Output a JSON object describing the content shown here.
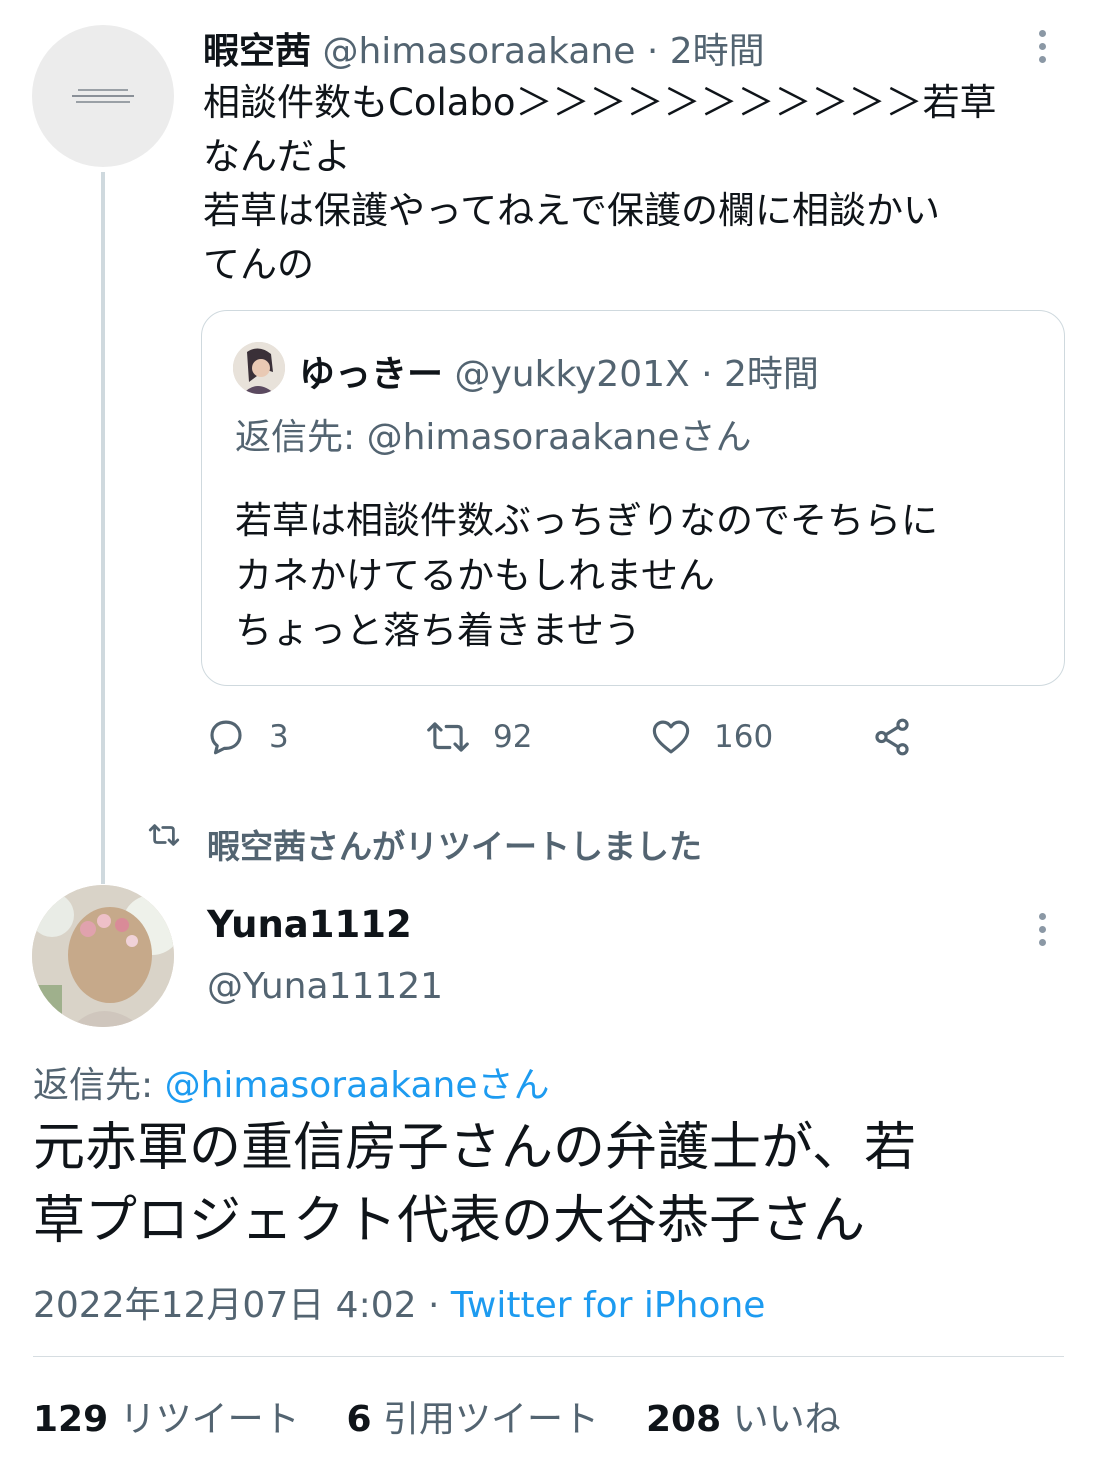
{
  "tweet1": {
    "author_name": "暇空茜",
    "author_handle": "@himasoraakane",
    "time": "· 2時間",
    "lines": [
      "相談件数もColabo＞＞＞＞＞＞＞＞＞＞＞若草",
      "なんだよ",
      "若草は保護やってねえで保護の欄に相談かい",
      "てんの"
    ],
    "quote": {
      "author_name": "ゆっきー",
      "author_handle": "@yukky201X",
      "time": "· 2時間",
      "reply_to": "返信先: @himasoraakaneさん",
      "lines": [
        "若草は相談件数ぶっちぎりなのでそちらに",
        "カネかけてるかもしれません",
        "ちょっと落ち着きませう"
      ]
    },
    "actions": {
      "replies": "3",
      "retweets": "92",
      "likes": "160"
    }
  },
  "retweet_context": "暇空茜さんがリツイートしました",
  "tweet2": {
    "author_name": "Yuna1112",
    "author_handle": "@Yuna11121",
    "reply_prefix": "返信先: ",
    "reply_handle": "@himasoraakaneさん",
    "lines": [
      "元赤軍の重信房子さんの弁護士が、若",
      "草プロジェクト代表の大谷恭子さん"
    ],
    "timestamp": "2022年12月07日 4:02 · ",
    "source": "Twitter for iPhone",
    "stats": {
      "retweets_count": "129",
      "retweets_label": "リツイート",
      "quotes_count": "6",
      "quotes_label": "引用ツイート",
      "likes_count": "208",
      "likes_label": "いいね"
    }
  },
  "colors": {
    "accent": "#1d9bf0",
    "text": "#0f1419",
    "muted": "#536471",
    "border": "#cfd9de"
  },
  "icons": [
    "more-icon",
    "reply-icon",
    "retweet-icon",
    "like-icon",
    "share-icon"
  ]
}
